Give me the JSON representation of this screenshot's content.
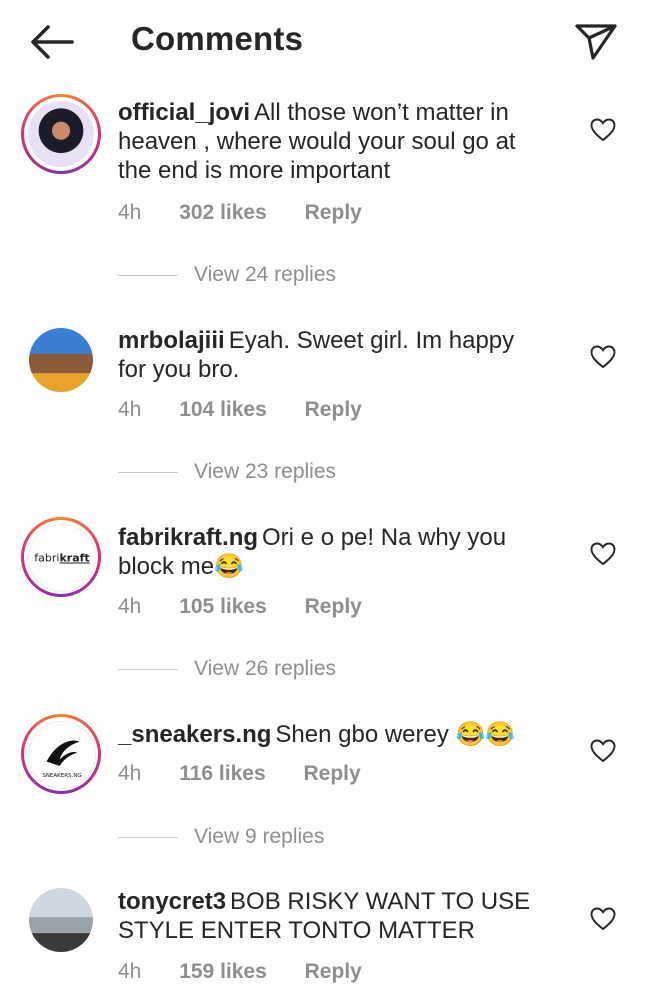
{
  "header": {
    "title": "Comments",
    "back_icon": "arrow-left-icon",
    "share_icon": "send-icon"
  },
  "comments": [
    {
      "username": "official_jovi",
      "text": "All those won’t matter in heaven , where would your soul go at the end is more important",
      "time": "4h",
      "likes": "302 likes",
      "reply": "Reply",
      "view_replies": "View 24 replies",
      "avatar_colors": [
        "#1b1b2a",
        "#c98a6a",
        "#e8e0f5"
      ]
    },
    {
      "username": "mrbolajiii",
      "text": "Eyah.  Sweet girl.  Im happy for you bro.",
      "time": "4h",
      "likes": "104 likes",
      "reply": "Reply",
      "view_replies": "View 23 replies",
      "avatar_colors": [
        "#3a7fd4",
        "#8a5a3a",
        "#e7a32a"
      ]
    },
    {
      "username": "fabrikraft.ng",
      "text": "Ori e o pe! Na why you block me😂",
      "time": "4h",
      "likes": "105 likes",
      "reply": "Reply",
      "view_replies": "View 26 replies",
      "avatar_logo": "fabrikraft"
    },
    {
      "username": "_sneakers.ng",
      "text": "Shen gbo werey 😂😂",
      "time": "4h",
      "likes": "116 likes",
      "reply": "Reply",
      "view_replies": "View 9 replies",
      "avatar_logo": "SNEAKERS.NG"
    },
    {
      "username": "tonycret3",
      "text": "BOB RISKY WANT TO USE STYLE ENTER TONTO MATTER",
      "time": "4h",
      "likes": "159 likes",
      "reply": "Reply"
    }
  ]
}
